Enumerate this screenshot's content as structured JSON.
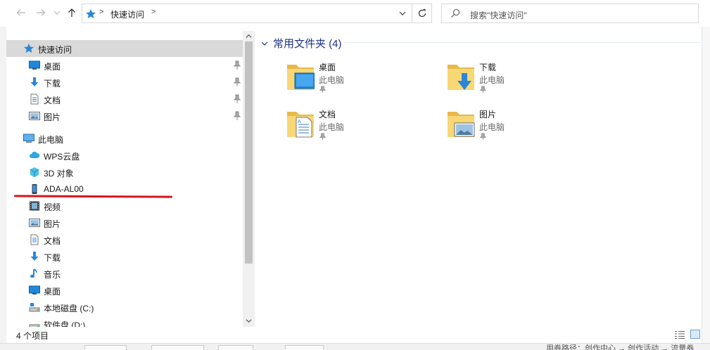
{
  "address": {
    "crumb": "快速访问",
    "sep1": ">",
    "sep2": ">"
  },
  "search": {
    "placeholder": "搜索\"快速访问\""
  },
  "nav": {
    "quick_access": "快速访问",
    "pinned": [
      {
        "label": "桌面",
        "icon": "desktop-icon"
      },
      {
        "label": "下载",
        "icon": "download-icon"
      },
      {
        "label": "文档",
        "icon": "document-icon"
      },
      {
        "label": "图片",
        "icon": "pictures-icon"
      }
    ],
    "this_pc": "此电脑",
    "pc_items": [
      {
        "label": "WPS云盘",
        "icon": "cloud-icon"
      },
      {
        "label": "3D 对象",
        "icon": "cube-icon"
      },
      {
        "label": "ADA-AL00",
        "icon": "phone-icon"
      },
      {
        "label": "视频",
        "icon": "video-icon"
      },
      {
        "label": "图片",
        "icon": "pictures-icon"
      },
      {
        "label": "文档",
        "icon": "document-icon"
      },
      {
        "label": "下载",
        "icon": "download-icon"
      },
      {
        "label": "音乐",
        "icon": "music-icon"
      },
      {
        "label": "桌面",
        "icon": "desktop-icon"
      },
      {
        "label": "本地磁盘 (C:)",
        "icon": "drive-icon"
      },
      {
        "label": "软件盘 (D:)",
        "icon": "drive-icon"
      }
    ]
  },
  "content": {
    "group_title": "常用文件夹 (4)",
    "folders": [
      {
        "name": "桌面",
        "location": "此电脑"
      },
      {
        "name": "下载",
        "location": "此电脑"
      },
      {
        "name": "文档",
        "location": "此电脑"
      },
      {
        "name": "图片",
        "location": "此电脑"
      }
    ]
  },
  "status": {
    "count": "4 个项目"
  },
  "background": {
    "text": "用券路径：创作中心 → 创作活动 → 流量券"
  },
  "colors": {
    "accent": "#1e3287",
    "selection": "#d9d9d9",
    "annotation": "#d9141b",
    "folder": "#f8d775"
  }
}
